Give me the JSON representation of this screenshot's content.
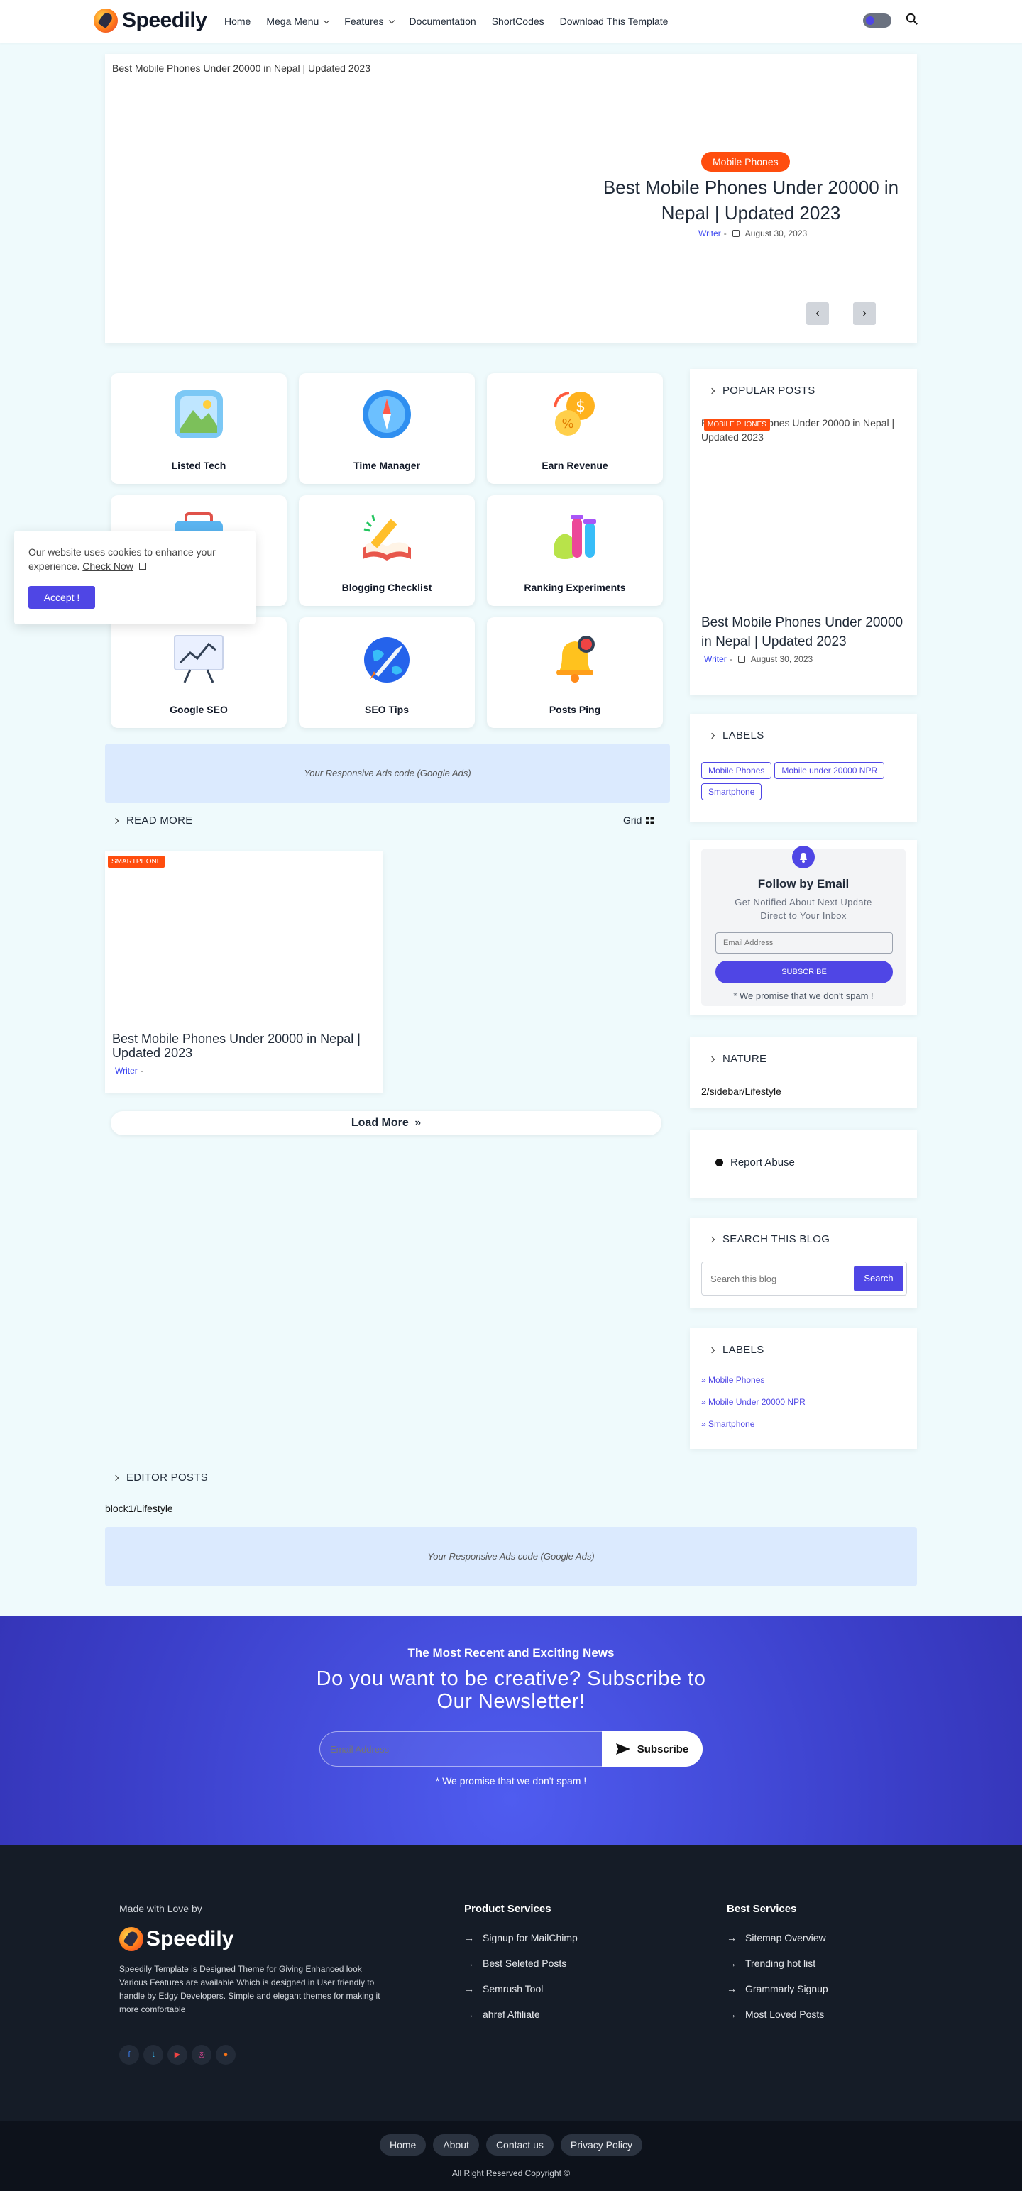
{
  "header": {
    "logo_text": "Speedily",
    "nav": [
      "Home",
      "Mega Menu",
      "Features",
      "Documentation",
      "ShortCodes",
      "Download This Template"
    ]
  },
  "hero": {
    "image_alt": "Best Mobile Phones Under 20000 in Nepal | Updated 2023",
    "badge": "Mobile Phones",
    "title": "Best Mobile Phones Under 20000 in Nepal | Updated 2023",
    "author": "Writer",
    "sep": "-",
    "date": "August 30, 2023",
    "prev": "‹",
    "next": "›"
  },
  "features": [
    {
      "label": "Listed Tech",
      "icon": "gallery-icon"
    },
    {
      "label": "Time Manager",
      "icon": "compass-icon"
    },
    {
      "label": "Earn Revenue",
      "icon": "coins-icon"
    },
    {
      "label": "",
      "icon": "briefcase-icon"
    },
    {
      "label": "Blogging Checklist",
      "icon": "book-pencil-icon"
    },
    {
      "label": "Ranking Experiments",
      "icon": "test-tubes-icon"
    },
    {
      "label": "Google SEO",
      "icon": "chart-board-icon"
    },
    {
      "label": "SEO Tips",
      "icon": "rocket-globe-icon"
    },
    {
      "label": "Posts Ping",
      "icon": "bell-icon"
    }
  ],
  "cookie": {
    "text": "Our website uses cookies to enhance your experience.",
    "link": "Check Now",
    "button": "Accept !"
  },
  "ads_text": "Your Responsive Ads code (Google Ads)",
  "read_more": {
    "heading": "READ MORE",
    "view": "Grid",
    "post": {
      "badge": "SMARTPHONE",
      "title": "Best Mobile Phones Under 20000 in Nepal | Updated 2023",
      "author": "Writer",
      "sep": "-"
    },
    "load_more": "Load More"
  },
  "sidebar": {
    "popular": {
      "heading": "POPULAR POSTS",
      "image_alt": "Best Mobile Phones Under 20000 in Nepal | Updated 2023",
      "badge": "MOBILE PHONES",
      "title": "Best Mobile Phones Under 20000 in Nepal | Updated 2023",
      "author": "Writer",
      "sep": "-",
      "date": "August 30, 2023"
    },
    "labels_cloud": {
      "heading": "LABELS",
      "tags": [
        "Mobile Phones",
        "Mobile under 20000 NPR",
        "Smartphone"
      ]
    },
    "follow": {
      "title": "Follow by Email",
      "subtitle": "Get Notified About Next Update Direct to Your Inbox",
      "placeholder": "Email Address",
      "button": "SUBSCRIBE",
      "note": "* We promise that we don't spam !"
    },
    "nature": {
      "heading": "NATURE",
      "text": "2/sidebar/Lifestyle"
    },
    "report": {
      "text": "Report Abuse"
    },
    "search": {
      "heading": "SEARCH THIS BLOG",
      "placeholder": "Search this blog",
      "button": "Search"
    },
    "labels_list": {
      "heading": "LABELS",
      "items": [
        "Mobile Phones",
        "Mobile Under 20000 NPR",
        "Smartphone"
      ]
    }
  },
  "editor": {
    "heading": "EDITOR POSTS",
    "text": "block1/Lifestyle"
  },
  "newsletter": {
    "kicker": "The Most Recent and Exciting News",
    "title": "Do you want to be creative? Subscribe to Our Newsletter!",
    "placeholder": "Email Address",
    "button": "Subscribe",
    "note": "* We promise that we don't spam !"
  },
  "footer": {
    "made_with": "Made with Love by",
    "logo_text": "Speedily",
    "about": "Speedily Template is Designed Theme for Giving Enhanced look Various Features are available Which is designed in User friendly to handle by Edgy Developers. Simple and elegant themes for making it more comfortable",
    "social": [
      "facebook-icon",
      "twitter-icon",
      "youtube-icon",
      "instagram-icon",
      "reddit-icon"
    ],
    "col1": {
      "title": "Product Services",
      "links": [
        "Signup for MailChimp",
        "Best Seleted Posts",
        "Semrush Tool",
        "ahref Affiliate"
      ]
    },
    "col2": {
      "title": "Best Services",
      "links": [
        "Sitemap Overview",
        "Trending hot list",
        "Grammarly Signup",
        "Most Loved Posts"
      ]
    },
    "bottom_links": [
      "Home",
      "About",
      "Contact us",
      "Privacy Policy"
    ],
    "copyright": "All Right Reserved Copyright ©"
  },
  "colors": {
    "accent": "#4f46e5",
    "badge": "#ff4d0e",
    "page_bg": "#effafc",
    "footer_bg": "#151c27"
  }
}
